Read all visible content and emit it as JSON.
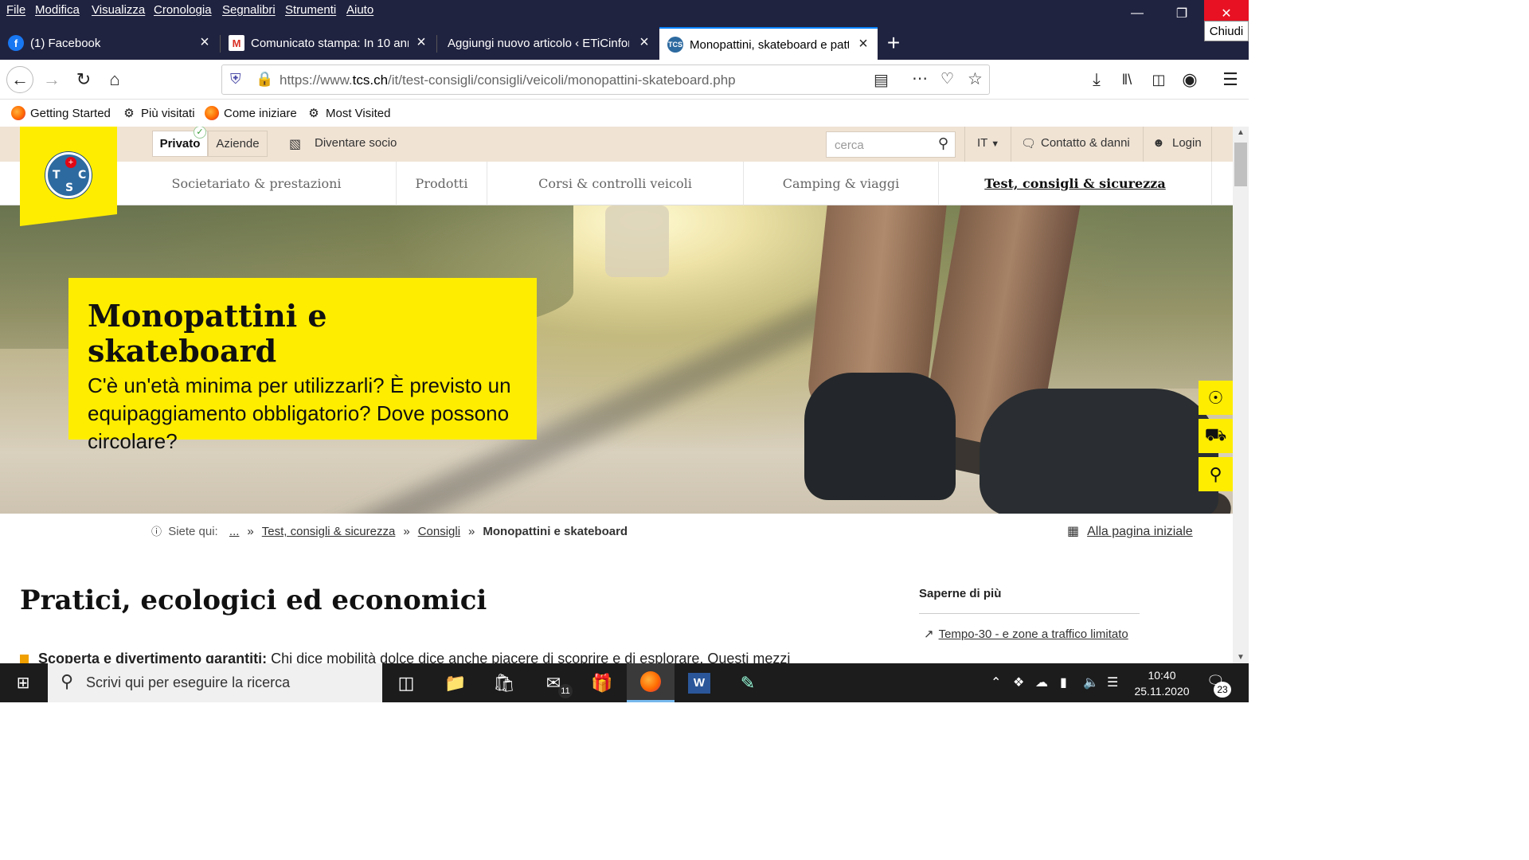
{
  "menubar": {
    "items": [
      "File",
      "Modifica",
      "Visualizza",
      "Cronologia",
      "Segnalibri",
      "Strumenti",
      "Aiuto"
    ],
    "close_tooltip": "Chiudi"
  },
  "tabs": [
    {
      "label": "(1) Facebook",
      "icon": "facebook-icon"
    },
    {
      "label": "Comunicato stampa: In 10 anni",
      "icon": "gmail-icon"
    },
    {
      "label": "Aggiungi nuovo articolo ‹ ETiCinfor",
      "icon": "wordpress-icon"
    },
    {
      "label": "Monopattini, skateboard e patt",
      "icon": "tcs-icon",
      "active": true
    }
  ],
  "urlbar": {
    "prefix": "https://www.",
    "domain": "tcs.ch",
    "path": "/it/test-consigli/consigli/veicoli/monopattini-skateboard.php"
  },
  "bookmarks": [
    {
      "label": "Getting Started",
      "icon": "firefox-icon"
    },
    {
      "label": "Più visitati",
      "icon": "gear-icon"
    },
    {
      "label": "Come iniziare",
      "icon": "firefox-icon"
    },
    {
      "label": "Most Visited",
      "icon": "gear-icon"
    }
  ],
  "site": {
    "segment": {
      "private": "Privato",
      "business": "Aziende"
    },
    "member": "Diventare socio",
    "search_placeholder": "cerca",
    "lang": "IT",
    "contact": "Contatto & danni",
    "login": "Login",
    "logo_letters": {
      "t": "T",
      "c": "C",
      "s": "S"
    },
    "nav": [
      "Societariato & prestazioni",
      "Prodotti",
      "Corsi & controlli veicoli",
      "Camping & viaggi",
      "Test, consigli & sicurezza"
    ]
  },
  "hero": {
    "title": "Monopattini e skateboard",
    "subtitle": "C'è un'età minima per utilizzarli? È previsto un equipaggiamento obbligatorio? Dove possono circolare?"
  },
  "breadcrumb": {
    "label": "Siete qui:",
    "items": [
      "...",
      "Test, consigli & sicurezza",
      "Consigli",
      "Monopattini e skateboard"
    ],
    "home": "Alla pagina iniziale"
  },
  "content": {
    "title": "Pratici, ecologici ed economici",
    "bullet_bold": "Scoperta e divertimento garantiti:",
    "bullet_text": " Chi dice mobilità dolce dice anche piacere di scoprire e di esplorare. Questi mezzi"
  },
  "sidebar": {
    "title": "Saperne di più",
    "link": "Tempo-30 - e zone a traffico limitato"
  },
  "taskbar": {
    "search_placeholder": "Scrivi qui per eseguire la ricerca",
    "mail_badge": "11",
    "time": "10:40",
    "date": "25.11.2020",
    "notifications": "23"
  }
}
